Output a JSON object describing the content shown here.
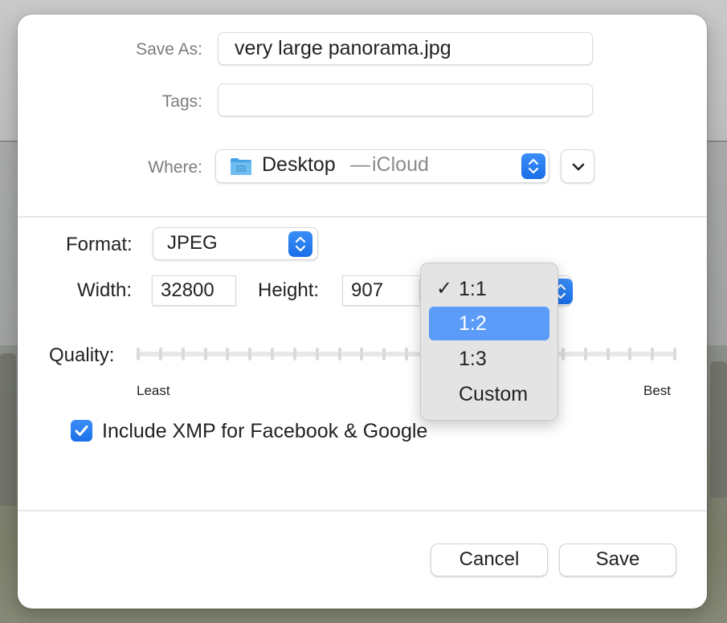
{
  "dialog": {
    "save_as": {
      "label": "Save As:",
      "value": "very large panorama.jpg"
    },
    "tags": {
      "label": "Tags:",
      "value": "",
      "placeholder": ""
    },
    "where": {
      "label": "Where:",
      "folder_icon": "folder-icon",
      "location": "Desktop",
      "separator": " — ",
      "service": "iCloud",
      "expand_icon": "chevron-down-icon"
    },
    "format": {
      "label": "Format:",
      "value": "JPEG"
    },
    "width": {
      "label": "Width:",
      "value": "32800"
    },
    "height": {
      "label": "Height:",
      "value": "907"
    },
    "quality": {
      "label": "Quality:",
      "min_label": "Least",
      "max_label": "Best",
      "tick_count": 25
    },
    "xmp": {
      "label": "Include XMP for Facebook & Google",
      "checked": true
    },
    "buttons": {
      "cancel": "Cancel",
      "save": "Save"
    }
  },
  "ratio_menu": {
    "items": [
      {
        "label": "1:1",
        "checked": true,
        "highlighted": false
      },
      {
        "label": "1:2",
        "checked": false,
        "highlighted": true
      },
      {
        "label": "1:3",
        "checked": false,
        "highlighted": false
      },
      {
        "label": "Custom",
        "checked": false,
        "highlighted": false
      }
    ],
    "check_glyph": "✓"
  },
  "colors": {
    "accent": "#1a6fe8",
    "menu_highlight": "#5a9cf8",
    "menu_bg": "#e4e4e4",
    "label_gray": "#7d7d7d"
  }
}
